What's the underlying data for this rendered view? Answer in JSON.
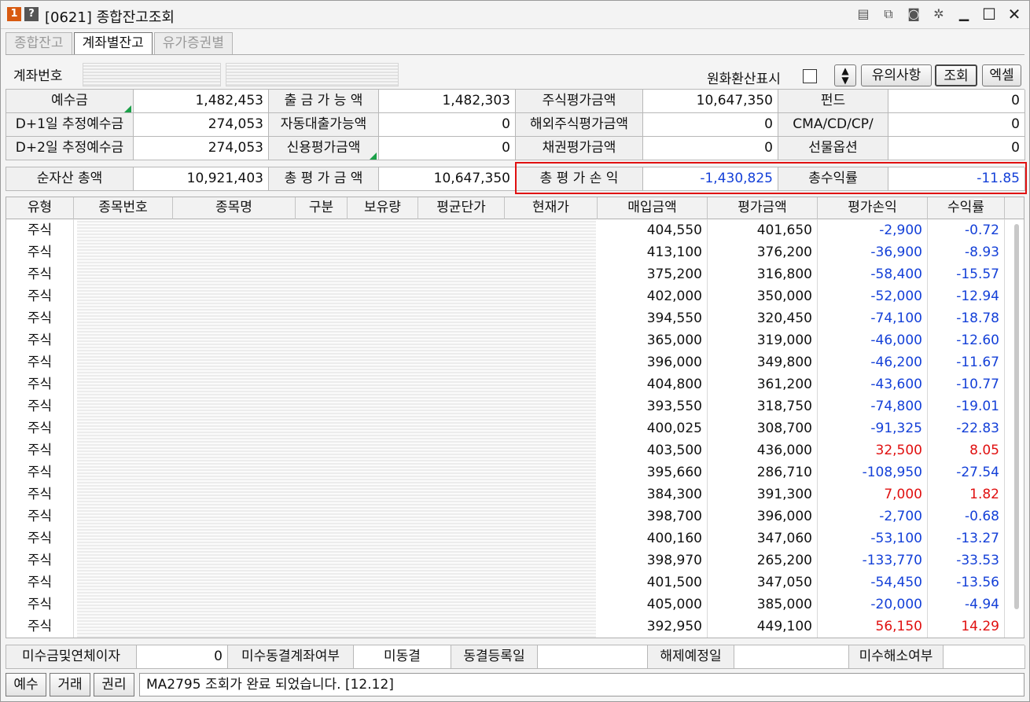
{
  "window": {
    "badge_num": "1",
    "badge_help": "?",
    "title": "[0621] 종합잔고조회",
    "icons": [
      "memo-icon",
      "copy-icon",
      "camera-icon",
      "gear-icon",
      "minimize-icon",
      "maximize-icon",
      "close-icon"
    ]
  },
  "tabs": [
    {
      "label": "종합잔고",
      "active": false
    },
    {
      "label": "계좌별잔고",
      "active": true
    },
    {
      "label": "유가증권별",
      "active": false
    }
  ],
  "account": {
    "label": "계좌번호",
    "fx_label": "원화환산표시",
    "buttons": {
      "notice": "유의사항",
      "query": "조회",
      "excel": "엑셀"
    }
  },
  "summary": {
    "rows": [
      [
        {
          "label": "예수금",
          "value": "1,482,453"
        },
        {
          "label": "출 금 가 능 액",
          "value": "1,482,303"
        },
        {
          "label": "주식평가금액",
          "value": "10,647,350"
        },
        {
          "label": "펀드",
          "value": "0"
        }
      ],
      [
        {
          "label": "D+1일 추정예수금",
          "value": "274,053"
        },
        {
          "label": "자동대출가능액",
          "value": "0"
        },
        {
          "label": "해외주식평가금액",
          "value": "0"
        },
        {
          "label": "CMA/CD/CP/",
          "value": "0"
        }
      ],
      [
        {
          "label": "D+2일 추정예수금",
          "value": "274,053"
        },
        {
          "label": "신용평가금액",
          "value": "0"
        },
        {
          "label": "채권평가금액",
          "value": "0"
        },
        {
          "label": "선물옵션",
          "value": "0"
        }
      ]
    ],
    "totals": [
      {
        "label": "순자산 총액",
        "value": "10,921,403"
      },
      {
        "label": "총 평 가 금 액",
        "value": "10,647,350"
      },
      {
        "label": "총 평 가 손 익",
        "value": "-1,430,825"
      },
      {
        "label": "총수익률",
        "value": "-11.85"
      }
    ]
  },
  "holdings": {
    "columns": [
      "유형",
      "종목번호",
      "종목명",
      "구분",
      "보유량",
      "평균단가",
      "현재가",
      "매입금액",
      "평가금액",
      "평가손익",
      "수익률"
    ],
    "rows": [
      {
        "type": "주식",
        "buy": "404,550",
        "eval": "401,650",
        "pl": "-2,900",
        "rate": "-0.72"
      },
      {
        "type": "주식",
        "buy": "413,100",
        "eval": "376,200",
        "pl": "-36,900",
        "rate": "-8.93"
      },
      {
        "type": "주식",
        "buy": "375,200",
        "eval": "316,800",
        "pl": "-58,400",
        "rate": "-15.57"
      },
      {
        "type": "주식",
        "buy": "402,000",
        "eval": "350,000",
        "pl": "-52,000",
        "rate": "-12.94"
      },
      {
        "type": "주식",
        "buy": "394,550",
        "eval": "320,450",
        "pl": "-74,100",
        "rate": "-18.78"
      },
      {
        "type": "주식",
        "buy": "365,000",
        "eval": "319,000",
        "pl": "-46,000",
        "rate": "-12.60"
      },
      {
        "type": "주식",
        "buy": "396,000",
        "eval": "349,800",
        "pl": "-46,200",
        "rate": "-11.67"
      },
      {
        "type": "주식",
        "buy": "404,800",
        "eval": "361,200",
        "pl": "-43,600",
        "rate": "-10.77"
      },
      {
        "type": "주식",
        "buy": "393,550",
        "eval": "318,750",
        "pl": "-74,800",
        "rate": "-19.01"
      },
      {
        "type": "주식",
        "buy": "400,025",
        "eval": "308,700",
        "pl": "-91,325",
        "rate": "-22.83"
      },
      {
        "type": "주식",
        "buy": "403,500",
        "eval": "436,000",
        "pl": "32,500",
        "rate": "8.05"
      },
      {
        "type": "주식",
        "buy": "395,660",
        "eval": "286,710",
        "pl": "-108,950",
        "rate": "-27.54"
      },
      {
        "type": "주식",
        "buy": "384,300",
        "eval": "391,300",
        "pl": "7,000",
        "rate": "1.82"
      },
      {
        "type": "주식",
        "buy": "398,700",
        "eval": "396,000",
        "pl": "-2,700",
        "rate": "-0.68"
      },
      {
        "type": "주식",
        "buy": "400,160",
        "eval": "347,060",
        "pl": "-53,100",
        "rate": "-13.27"
      },
      {
        "type": "주식",
        "buy": "398,970",
        "eval": "265,200",
        "pl": "-133,770",
        "rate": "-33.53"
      },
      {
        "type": "주식",
        "buy": "401,500",
        "eval": "347,050",
        "pl": "-54,450",
        "rate": "-13.56"
      },
      {
        "type": "주식",
        "buy": "405,000",
        "eval": "385,000",
        "pl": "-20,000",
        "rate": "-4.94"
      },
      {
        "type": "주식",
        "buy": "392,950",
        "eval": "449,100",
        "pl": "56,150",
        "rate": "14.29"
      }
    ]
  },
  "footer": {
    "items": [
      {
        "label": "미수금및연체이자",
        "value": "0"
      },
      {
        "label": "미수동결계좌여부",
        "value": "미동결"
      },
      {
        "label": "동결등록일",
        "value": ""
      },
      {
        "label": "해제예정일",
        "value": ""
      },
      {
        "label": "미수해소여부",
        "value": ""
      }
    ]
  },
  "statusbar": {
    "buttons": [
      "예수",
      "거래",
      "권리"
    ],
    "message": "MA2795 조회가 완료 되었습니다. [12.12]"
  },
  "colors": {
    "negative": "#1440d8",
    "positive": "#e01010",
    "highlight": "#e01010"
  }
}
